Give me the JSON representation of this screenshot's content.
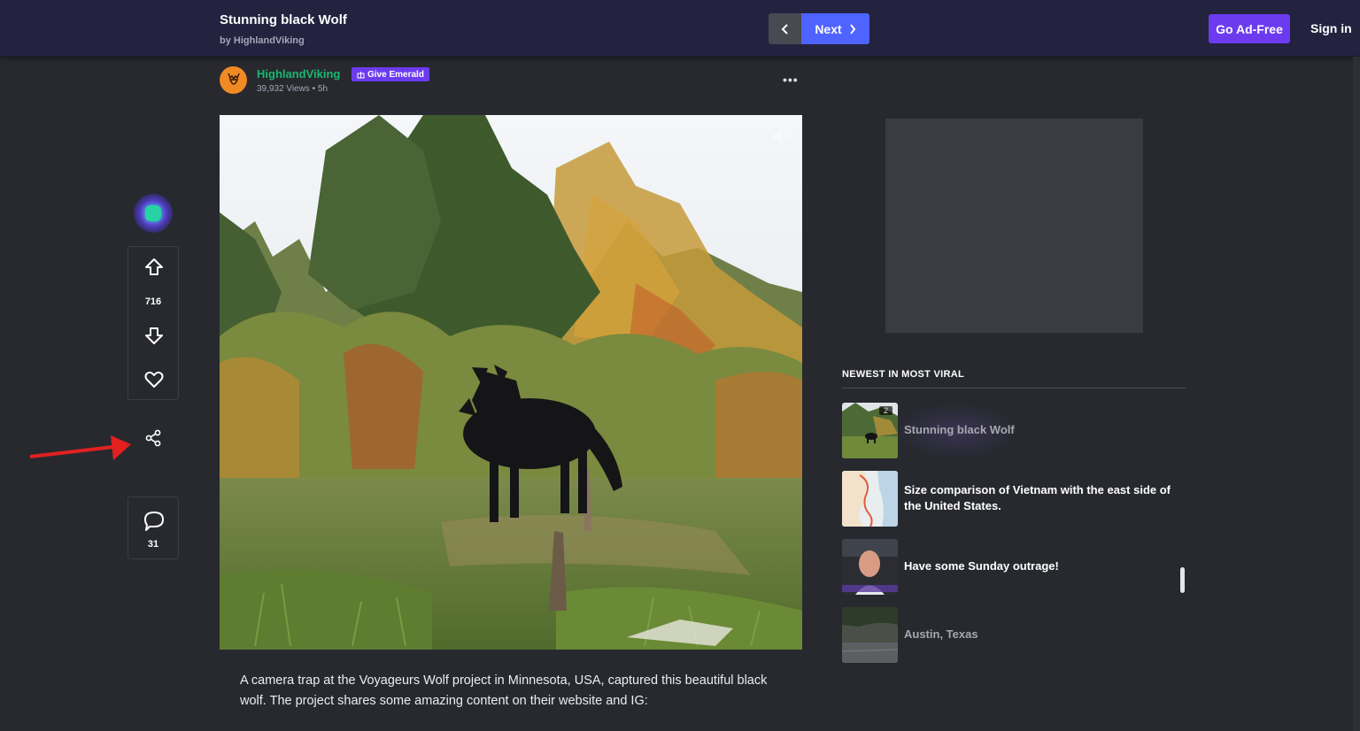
{
  "header": {
    "title": "Stunning black Wolf",
    "byline": "by HighlandViking",
    "next_label": "Next",
    "ad_free_label": "Go Ad-Free",
    "sign_in_label": "Sign in"
  },
  "author": {
    "name": "HighlandViking",
    "badge_label": "Give Emerald",
    "views": "39,932 Views",
    "age": "5h",
    "more_label": "•••"
  },
  "vote_bar": {
    "score": "716",
    "comments": "31"
  },
  "description": "A camera trap at the Voyageurs Wolf project in Minnesota, USA, captured this beautiful black wolf. The project shares some amazing content on their website and IG:",
  "sidebar": {
    "section_title": "NEWEST IN MOST VIRAL",
    "items": [
      {
        "title": "Stunning black Wolf",
        "count": "2",
        "thumb": "wolf"
      },
      {
        "title": "Size comparison of Vietnam with the east side of the United States.",
        "thumb": "map"
      },
      {
        "title": "Have some Sunday outrage!",
        "thumb": "person"
      },
      {
        "title": "Austin, Texas",
        "thumb": "street"
      }
    ]
  },
  "colors": {
    "accent_blue": "#4e63ff",
    "accent_purple": "#6c3bf0",
    "author_green": "#1bb76e",
    "annotation_red": "#e22020"
  },
  "icons": [
    "chevron-left-icon",
    "chevron-right-icon",
    "upvote-icon",
    "downvote-icon",
    "heart-icon",
    "share-icon",
    "comment-icon",
    "mute-icon",
    "gift-icon"
  ]
}
